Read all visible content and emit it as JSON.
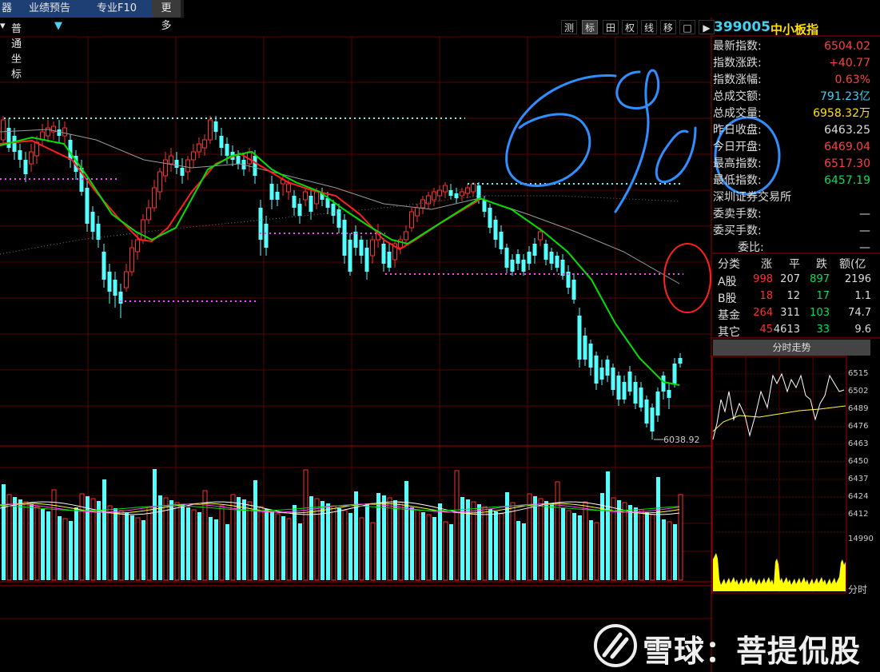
{
  "toolbar": {
    "tabs": [
      {
        "label": "器"
      },
      {
        "label": "业绩预告"
      },
      {
        "label": "专业F10"
      },
      {
        "label": "更多"
      }
    ]
  },
  "chart_controls": {
    "coord_label": "普通坐标",
    "tools": [
      "测",
      "标",
      "田",
      "权",
      "线",
      "移",
      "□",
      "▶"
    ]
  },
  "index": {
    "code": "399005",
    "name": "中小板指"
  },
  "quote": [
    {
      "label": "最新指数:",
      "value": "6504.02",
      "color": "#ff4040"
    },
    {
      "label": "指数涨跌:",
      "value": "+40.77",
      "color": "#ff4040"
    },
    {
      "label": "指数涨幅:",
      "value": "0.63%",
      "color": "#ff4040"
    },
    {
      "label": "总成交额:",
      "value": "791.23亿",
      "color": "#44d0f0"
    },
    {
      "label": "总成交量:",
      "value": "6958.32万",
      "color": "#ffe000"
    },
    {
      "label": "昨日收盘:",
      "value": "6463.25",
      "color": "#dddddd"
    },
    {
      "label": "今日开盘:",
      "value": "6469.04",
      "color": "#ff4040"
    },
    {
      "label": "最高指数:",
      "value": "6517.30",
      "color": "#ff4040"
    },
    {
      "label": "最低指数:",
      "value": "6457.19",
      "color": "#00e060"
    }
  ],
  "exchange": {
    "name": "深圳证券交易所",
    "rows": [
      {
        "label": "委卖手数:",
        "value": "—"
      },
      {
        "label": "委买手数:",
        "value": "—"
      },
      {
        "label": "委比:",
        "value": "—"
      }
    ]
  },
  "breadth": {
    "headers": [
      "分类",
      "涨",
      "平",
      "跌",
      "额(亿"
    ],
    "rows": [
      {
        "cat": "A股",
        "up": "998",
        "flat": "207",
        "down": "897",
        "amount": "2196"
      },
      {
        "cat": "B股",
        "up": "18",
        "flat": "12",
        "down": "17",
        "amount": "1.1"
      },
      {
        "cat": "基金",
        "up": "264",
        "flat": "311",
        "down": "103",
        "amount": "74.7"
      },
      {
        "cat": "其它",
        "up": "45",
        "flat": "4613",
        "down": "33",
        "amount": "9.6"
      }
    ]
  },
  "intraday": {
    "title": "分时走势",
    "price_labels": [
      "6515",
      "6502",
      "6489",
      "6476",
      "6463",
      "6450",
      "6437",
      "6424",
      "6412"
    ],
    "volume_label": "14990",
    "time_label": "分时"
  },
  "kline": {
    "low_marker": "6038.92"
  },
  "annotations": {
    "handwriting": "6970"
  },
  "watermark": {
    "text": "雪球：菩提侃股"
  },
  "colors": {
    "up": "#ff3030",
    "down": "#54ffff",
    "ma_short": "#00e000",
    "ma_mid": "#ff2020",
    "ma_long": "#9a9a9a",
    "support": "#ff40ff",
    "resistance": "#54ffff",
    "handwriting": "#2f8fff"
  }
}
